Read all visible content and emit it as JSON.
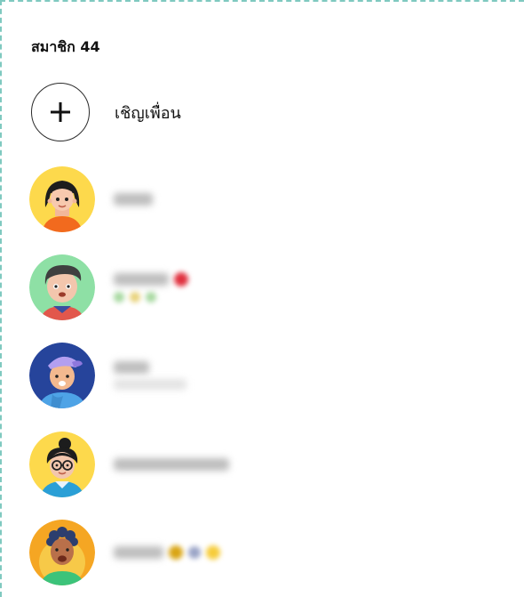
{
  "members": {
    "title": "สมาชิก 44",
    "invite_label": "เชิญเพื่อน",
    "list": [
      {
        "avatar": "avatar-girl-orange-shirt"
      },
      {
        "avatar": "avatar-boy-green-bg"
      },
      {
        "avatar": "avatar-boy-purple-cap"
      },
      {
        "avatar": "avatar-girl-glasses"
      },
      {
        "avatar": "avatar-boy-curly-hair"
      }
    ]
  },
  "icons": {
    "invite": "plus-icon"
  },
  "colors": {
    "accent_frame": "#7fc9c0",
    "avatar_yellow": "#fdd94c",
    "avatar_green": "#8ee0a5",
    "avatar_blue": "#26449b",
    "avatar_orange": "#f5a623"
  }
}
